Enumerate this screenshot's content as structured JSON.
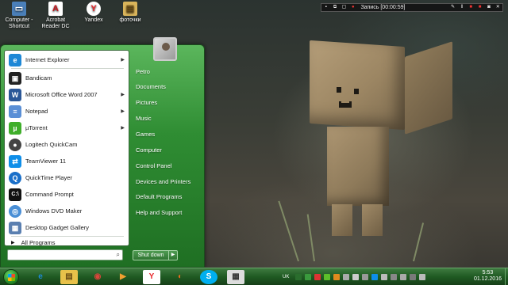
{
  "desktop_icons": [
    {
      "label": "Computer - Shortcut",
      "icon": "computer-icon"
    },
    {
      "label": "Acrobat Reader DC",
      "icon": "acrobat-icon"
    },
    {
      "label": "Yandex",
      "icon": "yandex-icon"
    },
    {
      "label": "фоточки",
      "icon": "folder-icon"
    }
  ],
  "recorder": {
    "status": "Запись [00:00:59]"
  },
  "start_menu": {
    "programs": [
      {
        "label": "Internet Explorer",
        "icon": "internet-explorer-icon",
        "has_submenu": true,
        "color": "#1e88d6"
      },
      {
        "label": "Bandicam",
        "icon": "bandicam-icon",
        "has_submenu": false,
        "color": "#222222"
      },
      {
        "label": "Microsoft Office Word 2007",
        "icon": "word-icon",
        "has_submenu": true,
        "color": "#2b5797"
      },
      {
        "label": "Notepad",
        "icon": "notepad-icon",
        "has_submenu": true,
        "color": "#5a8fd6"
      },
      {
        "label": "µTorrent",
        "icon": "utorrent-icon",
        "has_submenu": true,
        "color": "#3fae2a"
      },
      {
        "label": "Logitech QuickCam",
        "icon": "webcam-icon",
        "has_submenu": false,
        "color": "#444444"
      },
      {
        "label": "TeamViewer 11",
        "icon": "teamviewer-icon",
        "has_submenu": false,
        "color": "#0e8ee9"
      },
      {
        "label": "QuickTime Player",
        "icon": "quicktime-icon",
        "has_submenu": false,
        "color": "#1a6fc9"
      },
      {
        "label": "Command Prompt",
        "icon": "command-prompt-icon",
        "has_submenu": false,
        "color": "#111111"
      },
      {
        "label": "Windows DVD Maker",
        "icon": "dvd-maker-icon",
        "has_submenu": false,
        "color": "#4a8fd6"
      },
      {
        "label": "Desktop Gadget Gallery",
        "icon": "gadget-gallery-icon",
        "has_submenu": false,
        "color": "#5a7fb0"
      }
    ],
    "all_programs": "All Programs",
    "search_placeholder": "",
    "right_links": [
      "Petro",
      "Documents",
      "Pictures",
      "Music",
      "Games",
      "Computer",
      "Control Panel",
      "Devices and Printers",
      "Default Programs",
      "Help and Support"
    ],
    "shutdown_label": "Shut down"
  },
  "taskbar": {
    "pinned": [
      {
        "name": "taskbar-internet-explorer",
        "icon": "internet-explorer-icon",
        "color": "#1e88d6"
      },
      {
        "name": "taskbar-explorer",
        "icon": "folder-icon",
        "color": "#e8c14a"
      },
      {
        "name": "taskbar-chrome",
        "icon": "chrome-icon",
        "color": "#d9453b"
      },
      {
        "name": "taskbar-media-player",
        "icon": "media-player-icon",
        "color": "#f0a030"
      },
      {
        "name": "taskbar-yandex",
        "icon": "yandex-icon",
        "color": "#ffffff"
      },
      {
        "name": "taskbar-firefox",
        "icon": "firefox-icon",
        "color": "#e66a1e"
      },
      {
        "name": "taskbar-skype",
        "icon": "skype-icon",
        "color": "#00aff0"
      },
      {
        "name": "taskbar-calculator",
        "icon": "calculator-icon",
        "color": "#dddddd"
      }
    ],
    "language": "UK",
    "time": "5:53",
    "date": "01.12.2016"
  }
}
